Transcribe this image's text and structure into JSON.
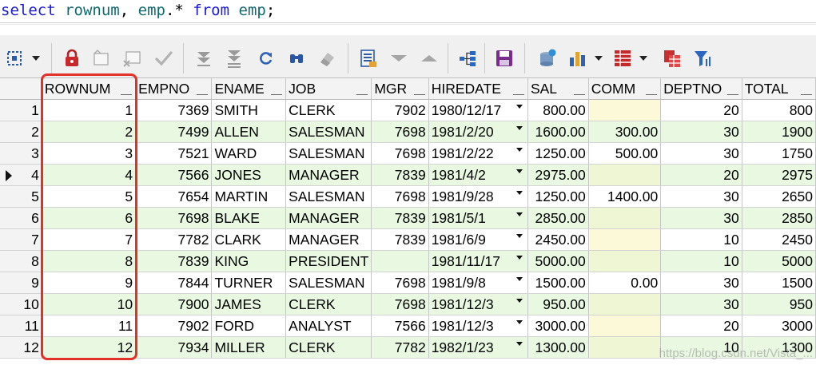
{
  "editor": {
    "sql_tokens": [
      {
        "text": "select",
        "kind": "kw"
      },
      {
        "text": " ",
        "kind": "pl"
      },
      {
        "text": "rownum",
        "kind": "id"
      },
      {
        "text": ", ",
        "kind": "pl"
      },
      {
        "text": "emp",
        "kind": "id"
      },
      {
        "text": ".* ",
        "kind": "pl"
      },
      {
        "text": "from",
        "kind": "kw"
      },
      {
        "text": " ",
        "kind": "pl"
      },
      {
        "text": "emp",
        "kind": "id"
      },
      {
        "text": ";",
        "kind": "pl"
      }
    ]
  },
  "toolbar": {
    "buttons": [
      {
        "name": "select-mode-icon"
      },
      {
        "name": "lock-icon"
      },
      {
        "name": "insert-record-icon"
      },
      {
        "name": "delete-record-icon"
      },
      {
        "name": "post-changes-icon"
      },
      {
        "name": "fetch-next-page-icon"
      },
      {
        "name": "fetch-last-page-icon"
      },
      {
        "name": "refresh-icon"
      },
      {
        "name": "find-icon"
      },
      {
        "name": "clear-icon"
      },
      {
        "name": "single-record-view-icon"
      },
      {
        "name": "next-record-icon"
      },
      {
        "name": "previous-record-icon"
      },
      {
        "name": "query-by-example-icon"
      },
      {
        "name": "save-icon"
      },
      {
        "name": "export-results-icon"
      },
      {
        "name": "chart-icon"
      },
      {
        "name": "print-grid-icon"
      },
      {
        "name": "copy-to-excel-icon"
      },
      {
        "name": "filter-icon"
      }
    ]
  },
  "grid": {
    "columns": [
      "ROWNUM",
      "EMPNO",
      "ENAME",
      "JOB",
      "MGR",
      "HIREDATE",
      "SAL",
      "COMM",
      "DEPTNO",
      "TOTAL"
    ],
    "current_row": 4,
    "rows": [
      {
        "n": "1",
        "rownum": "1",
        "empno": "7369",
        "ename": "SMITH",
        "job": "CLERK",
        "mgr": "7902",
        "hiredate": "1980/12/17",
        "sal": "800.00",
        "comm": "",
        "deptno": "20",
        "total": "800"
      },
      {
        "n": "2",
        "rownum": "2",
        "empno": "7499",
        "ename": "ALLEN",
        "job": "SALESMAN",
        "mgr": "7698",
        "hiredate": "1981/2/20",
        "sal": "1600.00",
        "comm": "300.00",
        "deptno": "30",
        "total": "1900"
      },
      {
        "n": "3",
        "rownum": "3",
        "empno": "7521",
        "ename": "WARD",
        "job": "SALESMAN",
        "mgr": "7698",
        "hiredate": "1981/2/22",
        "sal": "1250.00",
        "comm": "500.00",
        "deptno": "30",
        "total": "1750"
      },
      {
        "n": "4",
        "rownum": "4",
        "empno": "7566",
        "ename": "JONES",
        "job": "MANAGER",
        "mgr": "7839",
        "hiredate": "1981/4/2",
        "sal": "2975.00",
        "comm": "",
        "deptno": "20",
        "total": "2975"
      },
      {
        "n": "5",
        "rownum": "5",
        "empno": "7654",
        "ename": "MARTIN",
        "job": "SALESMAN",
        "mgr": "7698",
        "hiredate": "1981/9/28",
        "sal": "1250.00",
        "comm": "1400.00",
        "deptno": "30",
        "total": "2650"
      },
      {
        "n": "6",
        "rownum": "6",
        "empno": "7698",
        "ename": "BLAKE",
        "job": "MANAGER",
        "mgr": "7839",
        "hiredate": "1981/5/1",
        "sal": "2850.00",
        "comm": "",
        "deptno": "30",
        "total": "2850"
      },
      {
        "n": "7",
        "rownum": "7",
        "empno": "7782",
        "ename": "CLARK",
        "job": "MANAGER",
        "mgr": "7839",
        "hiredate": "1981/6/9",
        "sal": "2450.00",
        "comm": "",
        "deptno": "10",
        "total": "2450"
      },
      {
        "n": "8",
        "rownum": "8",
        "empno": "7839",
        "ename": "KING",
        "job": "PRESIDENT",
        "mgr": "",
        "hiredate": "1981/11/17",
        "sal": "5000.00",
        "comm": "",
        "deptno": "10",
        "total": "5000"
      },
      {
        "n": "9",
        "rownum": "9",
        "empno": "7844",
        "ename": "TURNER",
        "job": "SALESMAN",
        "mgr": "7698",
        "hiredate": "1981/9/8",
        "sal": "1500.00",
        "comm": "0.00",
        "deptno": "30",
        "total": "1500"
      },
      {
        "n": "10",
        "rownum": "10",
        "empno": "7900",
        "ename": "JAMES",
        "job": "CLERK",
        "mgr": "7698",
        "hiredate": "1981/12/3",
        "sal": "950.00",
        "comm": "",
        "deptno": "30",
        "total": "950"
      },
      {
        "n": "11",
        "rownum": "11",
        "empno": "7902",
        "ename": "FORD",
        "job": "ANALYST",
        "mgr": "7566",
        "hiredate": "1981/12/3",
        "sal": "3000.00",
        "comm": "",
        "deptno": "20",
        "total": "3000"
      },
      {
        "n": "12",
        "rownum": "12",
        "empno": "7934",
        "ename": "MILLER",
        "job": "CLERK",
        "mgr": "7782",
        "hiredate": "1982/1/23",
        "sal": "1300.00",
        "comm": "",
        "deptno": "10",
        "total": "1300"
      }
    ]
  },
  "watermark": "https://blog.csdn.net/Vista_...",
  "colors": {
    "row_even": "#e8f8e1",
    "row_odd": "#ffffff",
    "null_cell": "#fbf9d8",
    "highlight": "#e3312a",
    "sql_keyword": "#1a1ad6",
    "sql_identifier": "#0f6b70"
  }
}
